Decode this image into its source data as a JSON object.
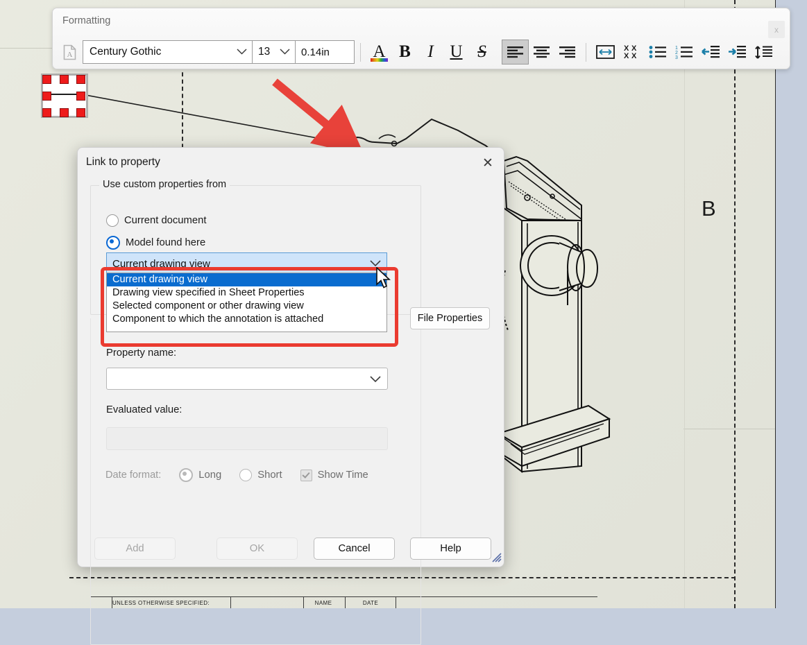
{
  "toolbar": {
    "title": "Formatting",
    "close_label": "x",
    "page_icon": "document-text-icon",
    "font_name": "Century Gothic",
    "font_size": "13",
    "line_spacing": "0.14in",
    "buttons": [
      {
        "name": "font-color-button",
        "label": "A"
      },
      {
        "name": "bold-button",
        "label": "B"
      },
      {
        "name": "italic-button",
        "label": "I"
      },
      {
        "name": "underline-button",
        "label": "U"
      },
      {
        "name": "strikethrough-button",
        "label": "S"
      }
    ],
    "align_buttons": [
      {
        "name": "align-left-button",
        "label": "Align Left",
        "active": true
      },
      {
        "name": "align-center-button",
        "label": "Align Center",
        "active": false
      },
      {
        "name": "align-right-button",
        "label": "Align Right",
        "active": false
      }
    ],
    "extra_buttons": [
      {
        "name": "fit-text-button",
        "label": "Fit Text"
      },
      {
        "name": "stack-text-button",
        "label": "Stacked Text"
      },
      {
        "name": "bullet-list-button",
        "label": "Bulleted List"
      },
      {
        "name": "numbered-list-button",
        "label": "Numbered List"
      },
      {
        "name": "decrease-indent-button",
        "label": "Decrease Indent"
      },
      {
        "name": "increase-indent-button",
        "label": "Increase Indent"
      },
      {
        "name": "line-spacing-button",
        "label": "Line Spacing"
      }
    ]
  },
  "dialog": {
    "title": "Link to property",
    "close_label": "✕",
    "group_legend": "Use custom properties from",
    "radios": [
      {
        "label": "Current document",
        "checked": false
      },
      {
        "label": "Model found here",
        "checked": true
      }
    ],
    "source_combo": {
      "value": "Current drawing view",
      "options": [
        "Current drawing view",
        "Drawing view specified in Sheet Properties",
        "Selected component or other drawing view",
        "Component to which the annotation is attached"
      ],
      "selected_index": 0
    },
    "file_properties_button": "File Properties",
    "property_name_label": "Property name:",
    "property_name_value": "",
    "evaluated_value_label": "Evaluated value:",
    "evaluated_value": "",
    "date_format_label": "Date format:",
    "date_options": [
      {
        "label": "Long",
        "checked": true
      },
      {
        "label": "Short",
        "checked": false
      }
    ],
    "show_time_label": "Show Time",
    "show_time_checked": true,
    "buttons": [
      {
        "name": "add-button",
        "label": "Add",
        "enabled": false
      },
      {
        "name": "ok-button",
        "label": "OK",
        "enabled": false
      },
      {
        "name": "cancel-button",
        "label": "Cancel",
        "enabled": true
      },
      {
        "name": "help-button",
        "label": "Help",
        "enabled": true
      }
    ]
  },
  "canvas": {
    "zone_letter": "B",
    "title_block": {
      "note": "UNLESS OTHERWISE SPECIFIED:",
      "col_name": "NAME",
      "col_date": "DATE"
    }
  },
  "colors": {
    "accent_blue": "#0a68d4",
    "selection_blue": "#0a6ccf",
    "annotation_red": "#ea3b30",
    "handle_red": "#ee1b1b",
    "canvas_bg": "#e5e6dc",
    "desktop_bg": "#c5cedd"
  }
}
